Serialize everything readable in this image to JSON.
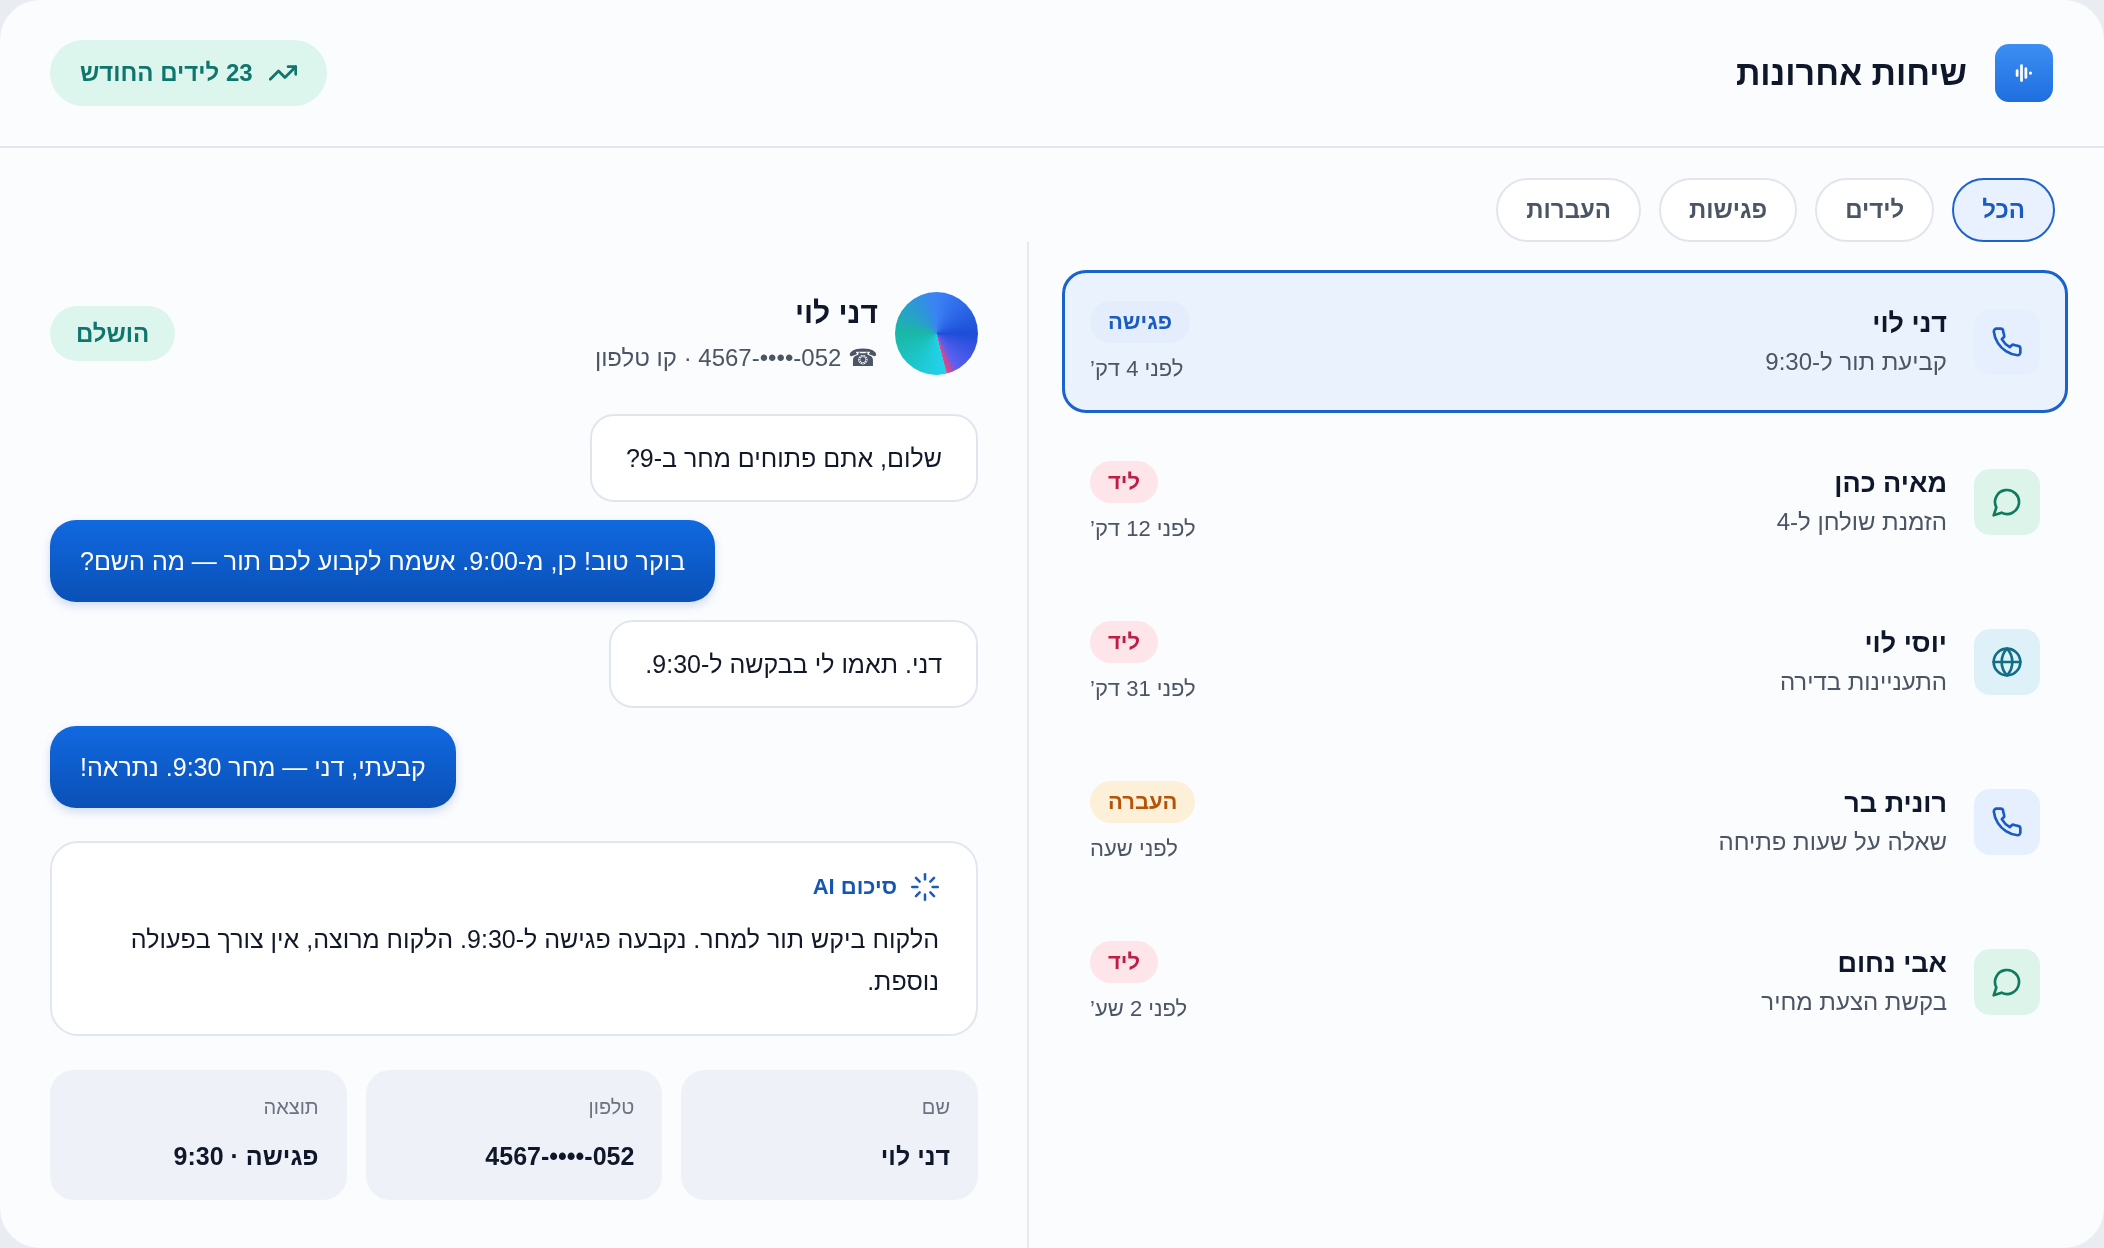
{
  "header": {
    "title": "שיחות אחרונות",
    "stat_badge": "23 לידים החודש"
  },
  "tabs": [
    {
      "label": "הכל",
      "selected": true
    },
    {
      "label": "לידים",
      "selected": false
    },
    {
      "label": "פגישות",
      "selected": false
    },
    {
      "label": "העברות",
      "selected": false
    }
  ],
  "conversations": [
    {
      "kind": "phone",
      "name": "דני לוי",
      "summary": "קביעת תור ל-9:30",
      "tag": {
        "kind": "meeting",
        "label": "פגישה"
      },
      "time": "לפני 4 דק’",
      "selected": true
    },
    {
      "kind": "chat",
      "name": "מאיה כהן",
      "summary": "הזמנת שולחן ל-4",
      "tag": {
        "kind": "lead",
        "label": "ליד"
      },
      "time": "לפני 12 דק’",
      "selected": false
    },
    {
      "kind": "web",
      "name": "יוסי לוי",
      "summary": "התעניינות בדירה",
      "tag": {
        "kind": "lead",
        "label": "ליד"
      },
      "time": "לפני 31 דק’",
      "selected": false
    },
    {
      "kind": "phone",
      "name": "רונית בר",
      "summary": "שאלה על שעות פתיחה",
      "tag": {
        "kind": "transfer",
        "label": "העברה"
      },
      "time": "לפני שעה",
      "selected": false
    },
    {
      "kind": "chat",
      "name": "אבי נחום",
      "summary": "בקשת הצעת מחיר",
      "tag": {
        "kind": "lead",
        "label": "ליד"
      },
      "time": "לפני 2 שע’",
      "selected": false
    }
  ],
  "contact": {
    "name": "דני לוי",
    "subtitle": "☎ 052-••••-4567 · קו טלפון",
    "status": "הושלם"
  },
  "messages": [
    {
      "kind": "customer",
      "text": "שלום, אתם פתוחים מחר ב-9?"
    },
    {
      "kind": "agent",
      "text": "בוקר טוב! כן, מ-9:00. אשמח לקבוע לכם תור — מה השם?"
    },
    {
      "kind": "customer",
      "text": "דני. תאמו לי בבקשה ל-9:30."
    },
    {
      "kind": "agent",
      "text": "קבעתי, דני — מחר 9:30. נתראה!"
    }
  ],
  "ai_summary": {
    "title": "סיכום AI",
    "text": "הלקוח ביקש תור למחר. נקבעה פגישה ל-9:30. הלקוח מרוצה, אין צורך בפעולה נוספת."
  },
  "details": [
    {
      "label": "שם",
      "value": "דני לוי"
    },
    {
      "label": "טלפון",
      "value": "052-••••-4567"
    },
    {
      "label": "תוצאה",
      "value": "פגישה · 9:30"
    }
  ]
}
